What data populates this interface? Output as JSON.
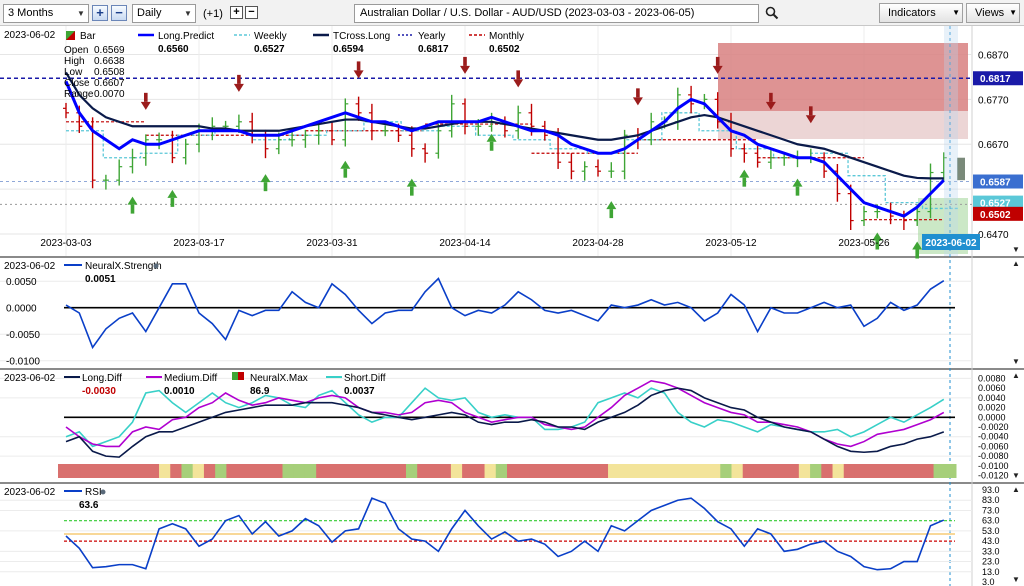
{
  "toolbar": {
    "period": "3 Months",
    "plus_label": "+",
    "minus_label": "−",
    "interval": "Daily",
    "offset": "(+1)",
    "plus2_label": "+",
    "minus2_label": "−",
    "title": "Australian Dollar / U.S. Dollar - AUD/USD (2023-03-03 - 2023-06-05)",
    "indicators_label": "Indicators",
    "views_label": "Views"
  },
  "colors": {
    "green_arrow": "#3fa535",
    "red_arrow": "#9b1c1c",
    "long_predict": "#0000ff",
    "tcross_long": "#0a1a4a",
    "weekly": "#5bc8d8",
    "yearly": "#1a1aa8",
    "monthly": "#c00000",
    "medium_diff": "#b000d0",
    "short_diff": "#38d0c8",
    "zone_red": "#d88080",
    "zone_green": "#a8d8a0"
  },
  "price_panel": {
    "date_label": "2023-06-02",
    "bar_label": "Bar",
    "ohlc": [
      {
        "label": "Open",
        "value": "0.6569"
      },
      {
        "label": "High",
        "value": "0.6638"
      },
      {
        "label": "Low",
        "value": "0.6508"
      },
      {
        "label": "Close",
        "value": "0.6607"
      },
      {
        "label": "Range",
        "value": "0.0070"
      }
    ],
    "legend": [
      {
        "name": "Long.Predict",
        "value": "0.6560"
      },
      {
        "name": "Weekly",
        "value": "0.6527"
      },
      {
        "name": "TCross.Long",
        "value": "0.6594"
      },
      {
        "name": "Yearly",
        "value": "0.6817"
      },
      {
        "name": "Monthly",
        "value": "0.6502"
      }
    ],
    "y_ticks": [
      "0.6870",
      "0.6770",
      "0.6670",
      "0.6470"
    ],
    "badges": [
      {
        "text": "0.6817",
        "bg": "#1a1aa8"
      },
      {
        "text": "0.6587",
        "bg": "#3a6fd0"
      },
      {
        "text": "0.6527",
        "bg": "#5bc8d8"
      },
      {
        "text": "0.6502",
        "bg": "#c00000"
      }
    ],
    "x_ticks": [
      "2023-03-03",
      "2023-03-17",
      "2023-03-31",
      "2023-04-14",
      "2023-04-28",
      "2023-05-12",
      "2023-05-26"
    ],
    "current_date": "2023-06-02"
  },
  "neuralx_panel": {
    "date_label": "2023-06-02",
    "name": "NeuralX.Strength",
    "value": "0.0051",
    "y_ticks": [
      "0.0050",
      "0.0000",
      "-0.0050",
      "-0.0100"
    ]
  },
  "diff_panel": {
    "date_label": "2023-06-02",
    "legend": [
      {
        "name": "Long.Diff",
        "value": "-0.0030"
      },
      {
        "name": "Medium.Diff",
        "value": "0.0010"
      },
      {
        "name": "NeuralX.Max",
        "value": "86.9"
      },
      {
        "name": "Short.Diff",
        "value": "0.0037"
      }
    ],
    "y_ticks": [
      "0.0080",
      "0.0060",
      "0.0040",
      "0.0020",
      "0.0000",
      "-0.0020",
      "-0.0040",
      "-0.0060",
      "-0.0080",
      "-0.0100",
      "-0.0120"
    ]
  },
  "rsi_panel": {
    "date_label": "2023-06-02",
    "name": "RSI",
    "value": "63.6",
    "y_ticks": [
      "93.0",
      "83.0",
      "73.0",
      "63.0",
      "53.0",
      "43.0",
      "33.0",
      "23.0",
      "13.0",
      "3.0"
    ]
  },
  "chart_data": [
    {
      "type": "candlestick",
      "title": "Australian Dollar / U.S. Dollar - AUD/USD (2023-03-03 - 2023-06-05)",
      "x": [
        "2023-03-03",
        "2023-03-06",
        "2023-03-07",
        "2023-03-08",
        "2023-03-09",
        "2023-03-10",
        "2023-03-13",
        "2023-03-14",
        "2023-03-15",
        "2023-03-16",
        "2023-03-17",
        "2023-03-20",
        "2023-03-21",
        "2023-03-22",
        "2023-03-23",
        "2023-03-24",
        "2023-03-27",
        "2023-03-28",
        "2023-03-29",
        "2023-03-30",
        "2023-03-31",
        "2023-04-03",
        "2023-04-04",
        "2023-04-05",
        "2023-04-06",
        "2023-04-07",
        "2023-04-10",
        "2023-04-11",
        "2023-04-12",
        "2023-04-13",
        "2023-04-14",
        "2023-04-17",
        "2023-04-18",
        "2023-04-19",
        "2023-04-20",
        "2023-04-21",
        "2023-04-24",
        "2023-04-25",
        "2023-04-26",
        "2023-04-27",
        "2023-04-28",
        "2023-05-01",
        "2023-05-02",
        "2023-05-03",
        "2023-05-04",
        "2023-05-05",
        "2023-05-08",
        "2023-05-09",
        "2023-05-10",
        "2023-05-11",
        "2023-05-12",
        "2023-05-15",
        "2023-05-16",
        "2023-05-17",
        "2023-05-18",
        "2023-05-19",
        "2023-05-22",
        "2023-05-23",
        "2023-05-24",
        "2023-05-25",
        "2023-05-26",
        "2023-05-29",
        "2023-05-30",
        "2023-05-31",
        "2023-06-01",
        "2023-06-02",
        "2023-06-05"
      ],
      "series": [
        {
          "name": "Bar",
          "values": [
            0.674,
            0.671,
            0.659,
            0.659,
            0.662,
            0.664,
            0.668,
            0.668,
            0.664,
            0.667,
            0.67,
            0.671,
            0.671,
            0.672,
            0.669,
            0.666,
            0.668,
            0.668,
            0.669,
            0.67,
            0.668,
            0.676,
            0.674,
            0.67,
            0.67,
            0.669,
            0.666,
            0.665,
            0.67,
            0.676,
            0.671,
            0.671,
            0.672,
            0.67,
            0.674,
            0.671,
            0.669,
            0.663,
            0.661,
            0.662,
            0.661,
            0.661,
            0.669,
            0.668,
            0.672,
            0.672,
            0.678,
            0.676,
            0.677,
            0.672,
            0.666,
            0.665,
            0.663,
            0.664,
            0.664,
            0.664,
            0.664,
            0.661,
            0.656,
            0.65,
            0.652,
            0.652,
            0.651,
            0.65,
            0.652,
            0.6607,
            0.664
          ]
        },
        {
          "name": "Long.Predict",
          "values": [
            0.681,
            0.674,
            0.67,
            0.668,
            0.666,
            0.668,
            0.667,
            0.667,
            0.668,
            0.669,
            0.67,
            0.67,
            0.67,
            0.67,
            0.669,
            0.669,
            0.669,
            0.67,
            0.671,
            0.672,
            0.673,
            0.674,
            0.673,
            0.672,
            0.672,
            0.671,
            0.67,
            0.671,
            0.672,
            0.672,
            0.672,
            0.672,
            0.673,
            0.672,
            0.671,
            0.67,
            0.67,
            0.669,
            0.667,
            0.666,
            0.665,
            0.665,
            0.666,
            0.668,
            0.67,
            0.672,
            0.675,
            0.677,
            0.676,
            0.673,
            0.67,
            0.669,
            0.667,
            0.666,
            0.665,
            0.664,
            0.664,
            0.663,
            0.66,
            0.657,
            0.654,
            0.653,
            0.652,
            0.651,
            0.653,
            0.656,
            0.659
          ]
        },
        {
          "name": "TCross.Long",
          "values": [
            0.683,
            0.678,
            0.675,
            0.673,
            0.672,
            0.671,
            0.671,
            0.671,
            0.671,
            0.671,
            0.671,
            0.6705,
            0.6705,
            0.67,
            0.67,
            0.67,
            0.67,
            0.6705,
            0.671,
            0.6715,
            0.672,
            0.6725,
            0.6725,
            0.672,
            0.6715,
            0.671,
            0.6705,
            0.6705,
            0.671,
            0.6715,
            0.672,
            0.672,
            0.672,
            0.6715,
            0.671,
            0.6705,
            0.67,
            0.6695,
            0.669,
            0.6685,
            0.668,
            0.668,
            0.6685,
            0.669,
            0.67,
            0.671,
            0.672,
            0.673,
            0.6735,
            0.673,
            0.672,
            0.671,
            0.67,
            0.669,
            0.668,
            0.667,
            0.6665,
            0.666,
            0.665,
            0.664,
            0.663,
            0.662,
            0.661,
            0.66,
            0.6595,
            0.6594,
            0.6594
          ]
        }
      ],
      "reference_lines": [
        {
          "name": "Yearly",
          "value": 0.6817
        },
        {
          "name": "Monthly",
          "value": 0.6502
        }
      ],
      "ylim": [
        0.643,
        0.692
      ]
    },
    {
      "type": "line",
      "title": "NeuralX.Strength",
      "series": [
        {
          "name": "NeuralX.Strength",
          "values": [
            0.0005,
            -0.001,
            -0.0075,
            -0.004,
            -0.002,
            -0.001,
            -0.0045,
            0.0,
            0.0045,
            0.0045,
            -0.001,
            -0.003,
            -0.006,
            -0.0005,
            -0.0015,
            -0.0005,
            -0.0005,
            0.003,
            0.001,
            0.0,
            0.0045,
            0.0025,
            -0.0005,
            -0.003,
            -0.001,
            -0.0005,
            -0.0005,
            0.003,
            0.0055,
            0.0,
            -0.0015,
            -0.0005,
            -0.001,
            0.0005,
            0.003,
            0.0015,
            -0.0005,
            -0.001,
            -0.0005,
            -0.0015,
            -0.0025,
            0.0005,
            0.0,
            0.0005,
            0.0015,
            0.0005,
            0.001,
            0.0,
            -0.0025,
            -0.001,
            0.0025,
            0.0005,
            -0.0045,
            0.0,
            -0.001,
            -0.001,
            0.0,
            0.001,
            0.0,
            0.0005,
            -0.0035,
            -0.002,
            0.001,
            -0.0005,
            0.0005,
            0.0035,
            0.0051
          ]
        }
      ],
      "ylim": [
        -0.011,
        0.009
      ]
    },
    {
      "type": "line",
      "title": "Long.Diff / Medium.Diff / Short.Diff",
      "series": [
        {
          "name": "Long.Diff",
          "values": [
            -0.005,
            -0.004,
            -0.007,
            -0.008,
            -0.0082,
            -0.006,
            -0.004,
            -0.003,
            -0.003,
            -0.002,
            -0.001,
            0.0,
            0.001,
            0.0015,
            0.002,
            0.0025,
            0.0025,
            0.0025,
            0.003,
            0.003,
            0.003,
            0.0025,
            0.002,
            0.001,
            0.0005,
            0.0,
            -0.0005,
            0.0,
            0.0005,
            0.001,
            0.0005,
            -0.001,
            -0.0015,
            -0.001,
            -0.001,
            -0.0005,
            -0.001,
            -0.002,
            -0.002,
            -0.0025,
            -0.001,
            0.0,
            0.001,
            0.0025,
            0.0045,
            0.0055,
            0.006,
            0.0055,
            0.004,
            0.003,
            0.002,
            0.0015,
            0.0,
            -0.001,
            -0.002,
            -0.0025,
            -0.003,
            -0.0045,
            -0.006,
            -0.007,
            -0.0072,
            -0.007,
            -0.006,
            -0.0055,
            -0.0045,
            -0.004,
            -0.003
          ]
        },
        {
          "name": "Medium.Diff",
          "values": [
            -0.002,
            -0.004,
            -0.0055,
            -0.006,
            -0.006,
            -0.003,
            -0.002,
            -0.0025,
            -0.0005,
            0.0,
            0.002,
            0.003,
            0.005,
            0.0035,
            0.0025,
            0.003,
            0.004,
            0.0035,
            0.003,
            0.004,
            0.0045,
            0.004,
            0.002,
            0.001,
            0.001,
            0.0005,
            0.001,
            0.003,
            0.0035,
            0.003,
            0.001,
            0.0,
            -0.001,
            -0.0005,
            0.0,
            0.0,
            -0.0015,
            -0.002,
            -0.0025,
            -0.002,
            0.0,
            0.002,
            0.0045,
            0.006,
            0.0075,
            0.007,
            0.006,
            0.0045,
            0.003,
            0.002,
            0.001,
            0.0005,
            -0.001,
            -0.001,
            -0.0015,
            -0.002,
            -0.003,
            -0.0045,
            -0.0055,
            -0.006,
            -0.005,
            -0.0035,
            -0.003,
            -0.0025,
            -0.0015,
            -0.0005,
            0.001
          ]
        },
        {
          "name": "Short.Diff",
          "values": [
            -0.004,
            -0.003,
            -0.006,
            -0.005,
            -0.004,
            -0.001,
            0.005,
            0.0055,
            0.003,
            0.001,
            0.003,
            0.005,
            0.003,
            0.002,
            0.003,
            0.0045,
            0.004,
            0.0025,
            0.002,
            0.0045,
            0.0055,
            0.003,
            0.0005,
            -0.001,
            0.0,
            0.0,
            0.003,
            0.006,
            0.004,
            0.0035,
            0.004,
            0.001,
            0.0,
            0.0005,
            0.0,
            0.0,
            -0.0025,
            -0.0025,
            -0.002,
            -0.001,
            0.003,
            0.004,
            0.005,
            0.004,
            0.006,
            0.005,
            0.001,
            -0.001,
            -0.002,
            -0.0005,
            -0.001,
            -0.002,
            -0.003,
            -0.0015,
            -0.002,
            -0.0025,
            -0.003,
            -0.003,
            -0.0025,
            -0.004,
            -0.003,
            -0.0015,
            0.0,
            -0.001,
            0.0005,
            0.002,
            0.0037
          ]
        }
      ],
      "ylim": [
        -0.0125,
        0.0085
      ]
    },
    {
      "type": "line",
      "title": "RSI",
      "series": [
        {
          "name": "RSI",
          "values": [
            48,
            36,
            17,
            18,
            20,
            20,
            16,
            55,
            60,
            55,
            38,
            45,
            63,
            68,
            50,
            62,
            48,
            53,
            65,
            58,
            42,
            53,
            55,
            85,
            80,
            55,
            45,
            43,
            33,
            55,
            73,
            58,
            45,
            52,
            43,
            45,
            40,
            28,
            33,
            43,
            33,
            58,
            53,
            63,
            73,
            78,
            83,
            85,
            75,
            62,
            55,
            38,
            55,
            50,
            33,
            35,
            40,
            43,
            33,
            28,
            18,
            15,
            16,
            23,
            23,
            58,
            63.6
          ]
        }
      ],
      "ylim": [
        3,
        93
      ],
      "reference_lines": [
        63,
        43
      ]
    }
  ]
}
